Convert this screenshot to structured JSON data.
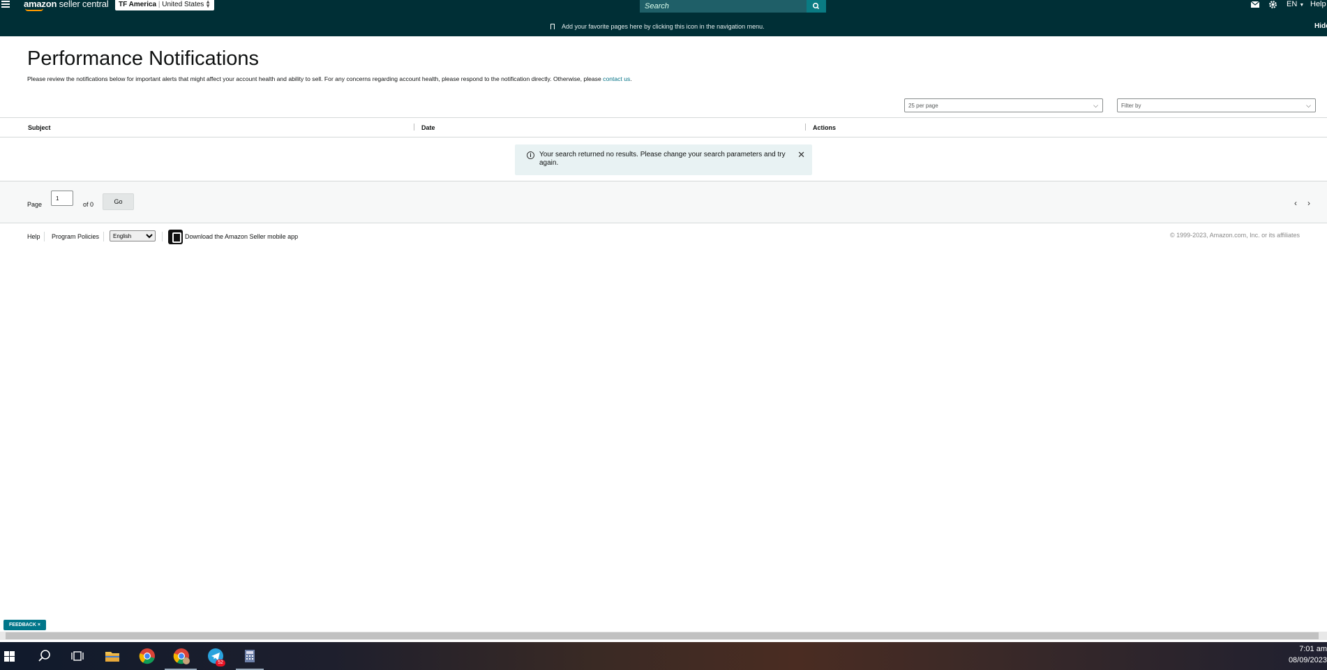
{
  "nav": {
    "logo_bold": "amazon",
    "logo_rest": " seller central",
    "account_name": "TF America",
    "account_sep": "|",
    "marketplace": "United States",
    "search_placeholder": "Search",
    "language": "EN",
    "help": "Help"
  },
  "favorites": {
    "message": "Add your favorite pages here by clicking this icon in the navigation menu.",
    "hide": "Hide"
  },
  "page": {
    "title": "Performance Notifications",
    "description": "Please review the notifications below for important alerts that might affect your account health and ability to sell. For any concerns regarding account health, please respond to the notification directly. Otherwise, please ",
    "contact_link": "contact us",
    "description_end": "."
  },
  "controls": {
    "per_page": "25 per page",
    "filter": "Filter by"
  },
  "table": {
    "columns": [
      "Subject",
      "Date",
      "Actions"
    ]
  },
  "alert": {
    "message": "Your search returned no results. Please change your search parameters and try again."
  },
  "pager": {
    "page_label": "Page",
    "page_value": "1",
    "of_label": "of 0",
    "go": "Go"
  },
  "footer": {
    "help": "Help",
    "policies": "Program Policies",
    "language": "English",
    "app_text": "Download the Amazon Seller mobile app",
    "copyright": "© 1999-2023, Amazon.com, Inc. or its affiliates"
  },
  "feedback": "FEEDBACK ×",
  "taskbar": {
    "telegram_badge": "52",
    "time": "7:01 am",
    "date": "08/09/2023"
  },
  "colors": {
    "nav_bg": "#002f36",
    "search_btn": "#0a7b83",
    "link": "#007185",
    "alert_bg": "#e8f2f3"
  }
}
